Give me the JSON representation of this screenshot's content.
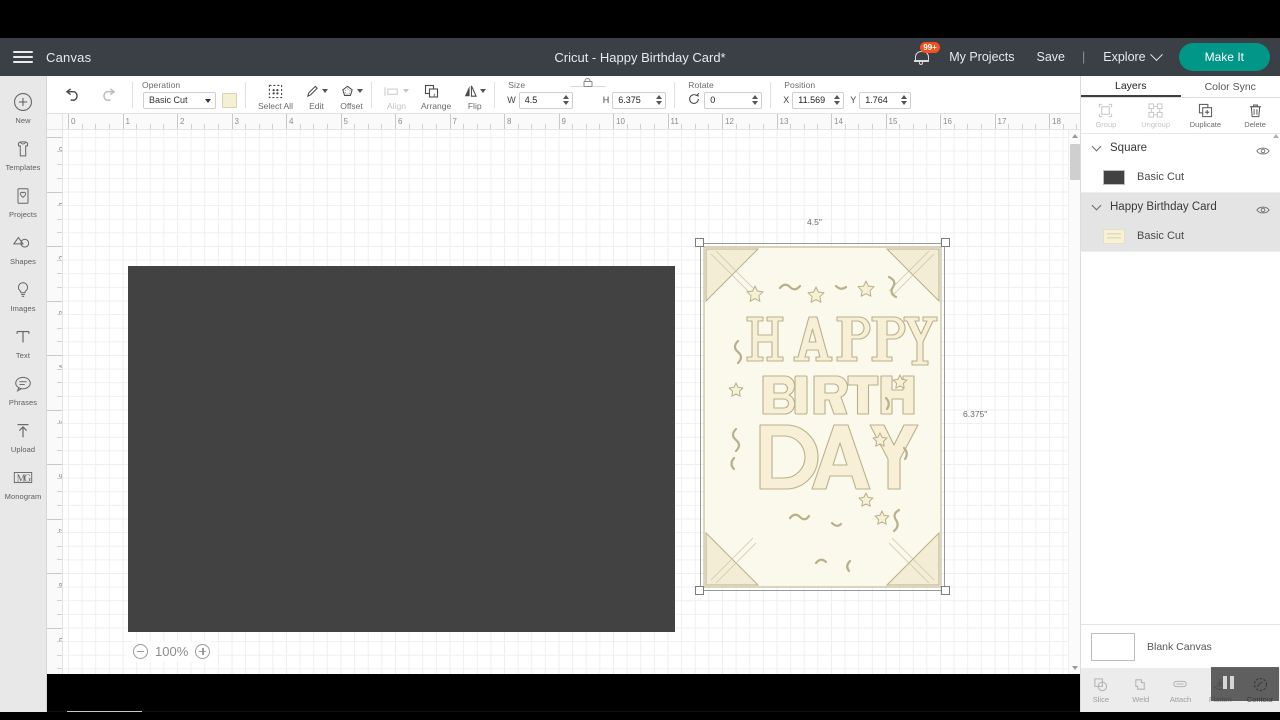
{
  "header": {
    "menu_icon": "hamburger-icon",
    "canvas_label": "Canvas",
    "title": "Cricut - Happy Birthday Card*",
    "notification_badge": "99+",
    "my_projects": "My Projects",
    "save": "Save",
    "divider": "|",
    "explore": "Explore",
    "make_it": "Make It",
    "accent_color": "#009688",
    "badge_color": "#f4511e",
    "bar_color": "#3b3f46"
  },
  "toolbar": {
    "operation_label": "Operation",
    "operation_value": "Basic Cut",
    "operation_color": "#f6f0d2",
    "select_all": "Select All",
    "edit": "Edit",
    "offset": "Offset",
    "align": "Align",
    "arrange": "Arrange",
    "flip": "Flip",
    "size_label": "Size",
    "width_label": "W",
    "width_value": "4.5",
    "height_label": "H",
    "height_value": "6.375",
    "rotate_label": "Rotate",
    "rotate_value": "0",
    "position_label": "Position",
    "x_label": "X",
    "x_value": "11.569",
    "y_label": "Y",
    "y_value": "1.764"
  },
  "sidebar": {
    "items": [
      {
        "label": "New",
        "icon": "plus-circle-icon"
      },
      {
        "label": "Templates",
        "icon": "tshirt-icon"
      },
      {
        "label": "Projects",
        "icon": "project-card-icon"
      },
      {
        "label": "Shapes",
        "icon": "shapes-icon"
      },
      {
        "label": "Images",
        "icon": "lightbulb-icon"
      },
      {
        "label": "Text",
        "icon": "text-t-icon"
      },
      {
        "label": "Phrases",
        "icon": "speech-bubble-icon"
      },
      {
        "label": "Upload",
        "icon": "upload-arrow-icon"
      },
      {
        "label": "Monogram",
        "icon": "monogram-icon"
      }
    ]
  },
  "canvas": {
    "ruler_h_ticks": [
      "0",
      "1",
      "2",
      "3",
      "4",
      "5",
      "6",
      "7",
      "8",
      "9",
      "10",
      "11",
      "12",
      "13",
      "14",
      "15",
      "16",
      "17",
      "18"
    ],
    "ruler_v_ticks": [
      "0",
      "1",
      "2",
      "3",
      "4",
      "5",
      "6",
      "7",
      "8",
      "9"
    ],
    "zoom_value": "100%",
    "zoom_out_icon": "minus-circle-icon",
    "zoom_in_icon": "plus-circle-icon",
    "width_dimension": "4.5\"",
    "height_dimension": "6.375\"",
    "square_color": "#424242",
    "card_fill": "#f8f2da",
    "card_stroke": "#bcb38c"
  },
  "right_panel": {
    "tabs": [
      {
        "label": "Layers",
        "active": true
      },
      {
        "label": "Color Sync",
        "active": false
      }
    ],
    "tools": [
      {
        "label": "Group",
        "icon": "group-icon",
        "enabled": false
      },
      {
        "label": "Ungroup",
        "icon": "ungroup-icon",
        "enabled": false
      },
      {
        "label": "Duplicate",
        "icon": "duplicate-icon",
        "enabled": true
      },
      {
        "label": "Delete",
        "icon": "trash-icon",
        "enabled": true
      }
    ],
    "layers": [
      {
        "name": "Square",
        "selected": false,
        "visibility_icon": "eye-icon",
        "children": [
          {
            "label": "Basic Cut",
            "swatch": "#424242",
            "type": "solid"
          }
        ]
      },
      {
        "name": "Happy Birthday Card",
        "selected": true,
        "visibility_icon": "eye-icon",
        "children": [
          {
            "label": "Basic Cut",
            "swatch": "#f7f1d8",
            "type": "pattern"
          }
        ]
      }
    ],
    "blank_canvas_label": "Blank Canvas",
    "bottom_ops": [
      {
        "label": "Slice",
        "icon": "slice-icon",
        "enabled": false
      },
      {
        "label": "Weld",
        "icon": "weld-icon",
        "enabled": false
      },
      {
        "label": "Attach",
        "icon": "attach-icon",
        "enabled": false
      },
      {
        "label": "Flatten",
        "icon": "flatten-icon",
        "enabled": false
      },
      {
        "label": "Contour",
        "icon": "contour-icon",
        "enabled": true
      }
    ]
  },
  "overlay": {
    "pause_icon": "pause-icon"
  }
}
